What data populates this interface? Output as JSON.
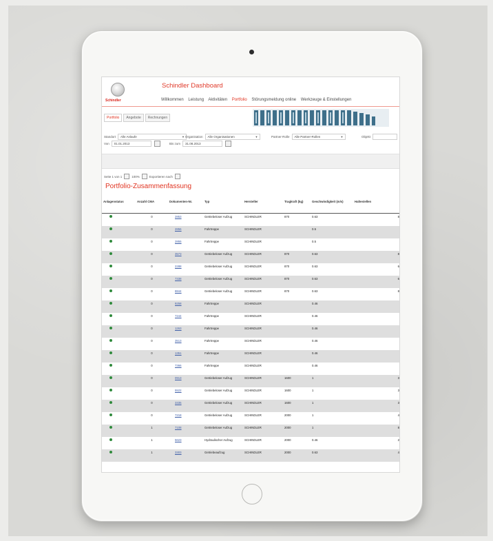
{
  "header": {
    "logo_text": "Schindler",
    "app_title": "Schindler Dashboard",
    "nav": [
      {
        "label": "Willkommen",
        "active": false
      },
      {
        "label": "Leistung",
        "active": false
      },
      {
        "label": "Aktivitäten",
        "active": false
      },
      {
        "label": "Portfolio",
        "active": true
      },
      {
        "label": "Störungsmeldung online",
        "active": false
      },
      {
        "label": "Werkzeuge & Einstellungen",
        "active": false
      }
    ],
    "accent_color": "#e0321f"
  },
  "tabs": [
    {
      "label": "Portfolio",
      "active": true
    },
    {
      "label": "Angebote",
      "active": false
    },
    {
      "label": "Rechnungen",
      "active": false
    }
  ],
  "filters": {
    "anlage_label": "Standort",
    "anlage_value": "Alle Anlaufe",
    "organisation_label": "Organisation",
    "organisation_value": "Alle Organisationen",
    "partner_label": "Partner-Rolle",
    "partner_value": "Alle Partner-Rollen",
    "objekt_label": "Objekt",
    "von_label": "Von",
    "von_value": "01.01.2013",
    "bis_label": "Bis zum",
    "bis_value": "31.08.2013"
  },
  "options": {
    "page_text": "Seite 1 von 1",
    "percent_text": "100%",
    "export_text": "Exportieren nach"
  },
  "section_title": "Portfolio-Zusammenfassung",
  "table": {
    "columns": [
      "Anlagenstatus",
      "Anzahl CMA",
      "Dokumenten-Nr.",
      "Typ",
      "Hersteller",
      "Tragkraft (kg)",
      "Geschwindigkeit (m/s)",
      "Haltestellen"
    ],
    "rows": [
      {
        "qty": "0",
        "doc": "2853",
        "type": "Getriebeloser Aufzug",
        "maker": "SCHINDLER",
        "load": "870",
        "speed": "0.63",
        "stops": "8"
      },
      {
        "qty": "0",
        "doc": "2856",
        "type": "Fahrtreppe",
        "maker": "SCHINDLER",
        "load": "",
        "speed": "0.5",
        "stops": ""
      },
      {
        "qty": "0",
        "doc": "2855",
        "type": "Fahrtreppe",
        "maker": "SCHINDLER",
        "load": "",
        "speed": "0.5",
        "stops": ""
      },
      {
        "qty": "0",
        "doc": "3573",
        "type": "Getriebeloser Aufzug",
        "maker": "SCHINDLER",
        "load": "870",
        "speed": "0.63",
        "stops": "8"
      },
      {
        "qty": "0",
        "doc": "2288",
        "type": "Getriebeloser Aufzug",
        "maker": "SCHINDLER",
        "load": "870",
        "speed": "0.63",
        "stops": "6"
      },
      {
        "qty": "0",
        "doc": "7338",
        "type": "Getriebeloser Aufzug",
        "maker": "SCHINDLER",
        "load": "870",
        "speed": "0.63",
        "stops": "6"
      },
      {
        "qty": "0",
        "doc": "8844",
        "type": "Getriebeloser Aufzug",
        "maker": "SCHINDLER",
        "load": "870",
        "speed": "0.63",
        "stops": "8"
      },
      {
        "qty": "0",
        "doc": "9258",
        "type": "Fahrtreppe",
        "maker": "SCHINDLER",
        "load": "",
        "speed": "0.46",
        "stops": ""
      },
      {
        "qty": "0",
        "doc": "7244",
        "type": "Fahrtreppe",
        "maker": "SCHINDLER",
        "load": "",
        "speed": "0.46",
        "stops": ""
      },
      {
        "qty": "0",
        "doc": "1263",
        "type": "Fahrtreppe",
        "maker": "SCHINDLER",
        "load": "",
        "speed": "0.46",
        "stops": ""
      },
      {
        "qty": "0",
        "doc": "3513",
        "type": "Fahrtreppe",
        "maker": "SCHINDLER",
        "load": "",
        "speed": "0.46",
        "stops": ""
      },
      {
        "qty": "0",
        "doc": "1351",
        "type": "Fahrtreppe",
        "maker": "SCHINDLER",
        "load": "",
        "speed": "0.46",
        "stops": ""
      },
      {
        "qty": "0",
        "doc": "7366",
        "type": "Fahrtreppe",
        "maker": "SCHINDLER",
        "load": "",
        "speed": "0.46",
        "stops": ""
      },
      {
        "qty": "0",
        "doc": "0913",
        "type": "Getriebeloser Aufzug",
        "maker": "SCHINDLER",
        "load": "1600",
        "speed": "1",
        "stops": "3"
      },
      {
        "qty": "0",
        "doc": "5522",
        "type": "Getriebeloser Aufzug",
        "maker": "SCHINDLER",
        "load": "1600",
        "speed": "1",
        "stops": "3"
      },
      {
        "qty": "0",
        "doc": "3335",
        "type": "Getriebeloser Aufzug",
        "maker": "SCHINDLER",
        "load": "1600",
        "speed": "1",
        "stops": "3"
      },
      {
        "qty": "0",
        "doc": "7218",
        "type": "Getriebeloser Aufzug",
        "maker": "SCHINDLER",
        "load": "2000",
        "speed": "1",
        "stops": "4"
      },
      {
        "qty": "1",
        "doc": "7108",
        "type": "Getriebeloser Aufzug",
        "maker": "SCHINDLER",
        "load": "2000",
        "speed": "1",
        "stops": "8"
      },
      {
        "qty": "1",
        "doc": "5623",
        "type": "Hydraulischer Aufzug",
        "maker": "SCHINDLER",
        "load": "2000",
        "speed": "0.46",
        "stops": "2"
      },
      {
        "qty": "1",
        "doc": "3303",
        "type": "Getriebeaufzug",
        "maker": "SCHINDLER",
        "load": "2000",
        "speed": "0.63",
        "stops": "4"
      }
    ]
  }
}
